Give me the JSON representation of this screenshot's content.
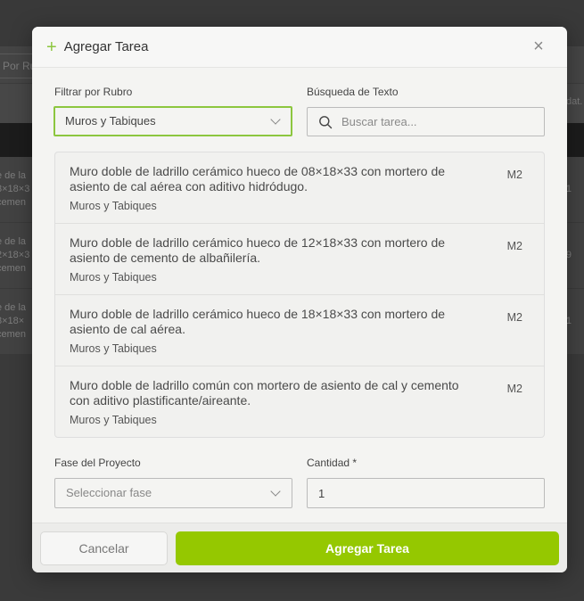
{
  "background": {
    "filter_label": "Por Ru",
    "right_text": "dat.",
    "rows": [
      {
        "lines": [
          "e de la",
          "8×18×3",
          "cemen"
        ],
        "num": "1"
      },
      {
        "lines": [
          "e de la",
          "2×18×3",
          "cemen"
        ],
        "num": "9"
      },
      {
        "lines": [
          "e de la",
          "8×18×",
          "cemen"
        ],
        "num": "1"
      }
    ]
  },
  "modal": {
    "title": "Agregar Tarea",
    "close_symbol": "×",
    "filter": {
      "label": "Filtrar por Rubro",
      "selected": "Muros y Tabiques"
    },
    "search": {
      "label": "Búsqueda de Texto",
      "placeholder": "Buscar tarea..."
    },
    "tasks": [
      {
        "title": "Muro doble de ladrillo cerámico hueco de 08×18×33 con mortero de asiento de cal aérea con aditivo hidródugo.",
        "category": "Muros y Tabiques",
        "unit": "M2"
      },
      {
        "title": "Muro doble de ladrillo cerámico hueco de 12×18×33 con mortero de asiento de cemento de albañilería.",
        "category": "Muros y Tabiques",
        "unit": "M2"
      },
      {
        "title": "Muro doble de ladrillo cerámico hueco de 18×18×33 con mortero de asiento de cal aérea.",
        "category": "Muros y Tabiques",
        "unit": "M2"
      },
      {
        "title": "Muro doble de ladrillo común con mortero de asiento de cal y cemento con aditivo plastificante/aireante.",
        "category": "Muros y Tabiques",
        "unit": "M2"
      }
    ],
    "phase": {
      "label": "Fase del Proyecto",
      "placeholder": "Seleccionar fase"
    },
    "quantity": {
      "label": "Cantidad *",
      "value": "1"
    },
    "buttons": {
      "cancel": "Cancelar",
      "submit": "Agregar Tarea"
    }
  },
  "colors": {
    "accent": "#95c800",
    "accent_border": "#8cc63f",
    "overlay": "#3a3a3a"
  }
}
